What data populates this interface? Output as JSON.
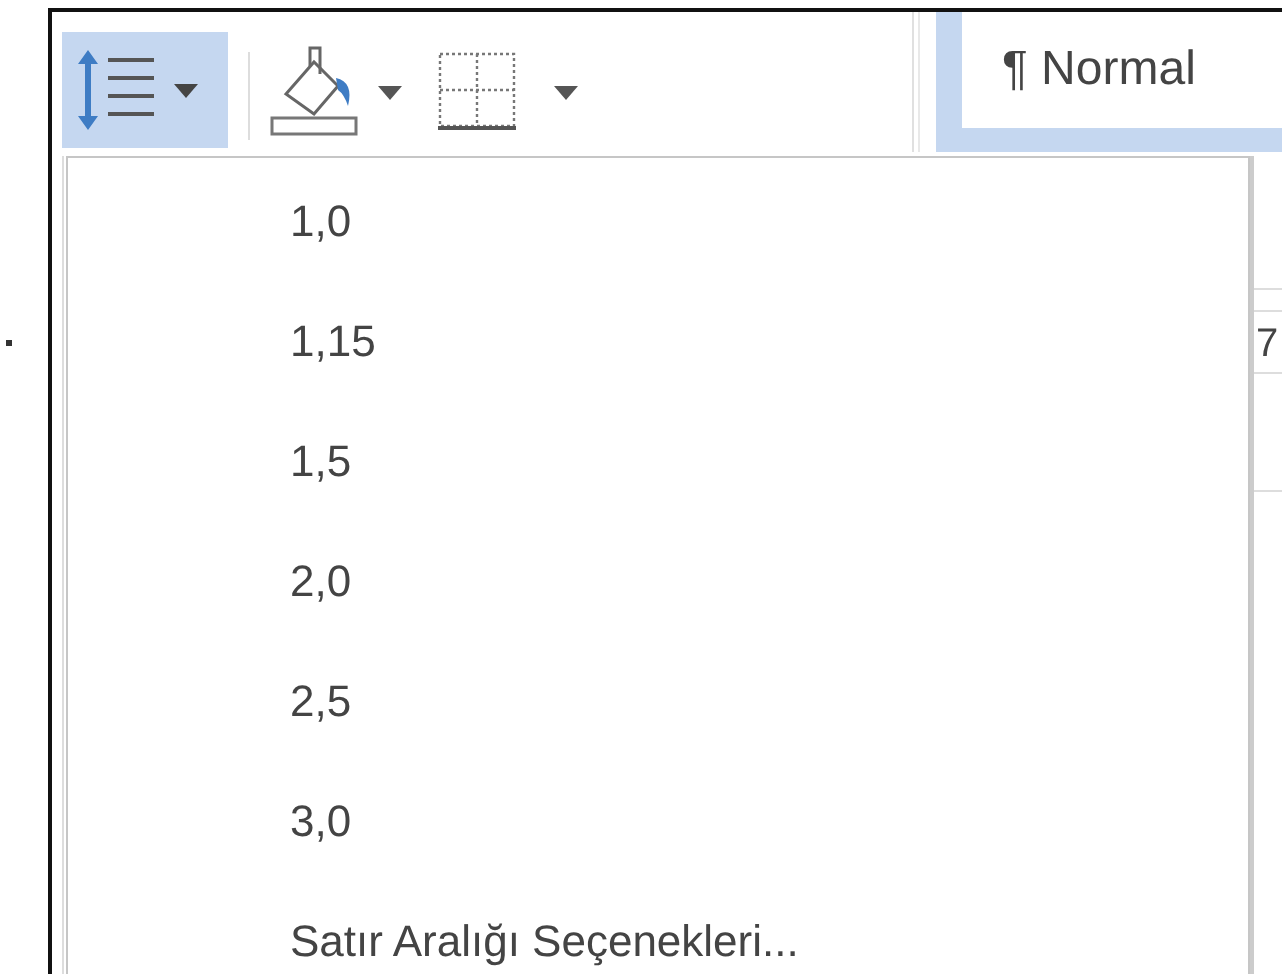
{
  "toolbar": {
    "line_spacing_button": {
      "selected": true
    },
    "style": {
      "label": "¶ Normal"
    }
  },
  "line_spacing_menu": {
    "items": [
      {
        "label": "1,0"
      },
      {
        "label": "1,15"
      },
      {
        "label": "1,5"
      },
      {
        "label": "2,0"
      },
      {
        "label": "2,5"
      },
      {
        "label": "3,0"
      },
      {
        "label": "Satır Aralığı Seçenekleri..."
      }
    ]
  },
  "document": {
    "right_edge_text": "7"
  }
}
